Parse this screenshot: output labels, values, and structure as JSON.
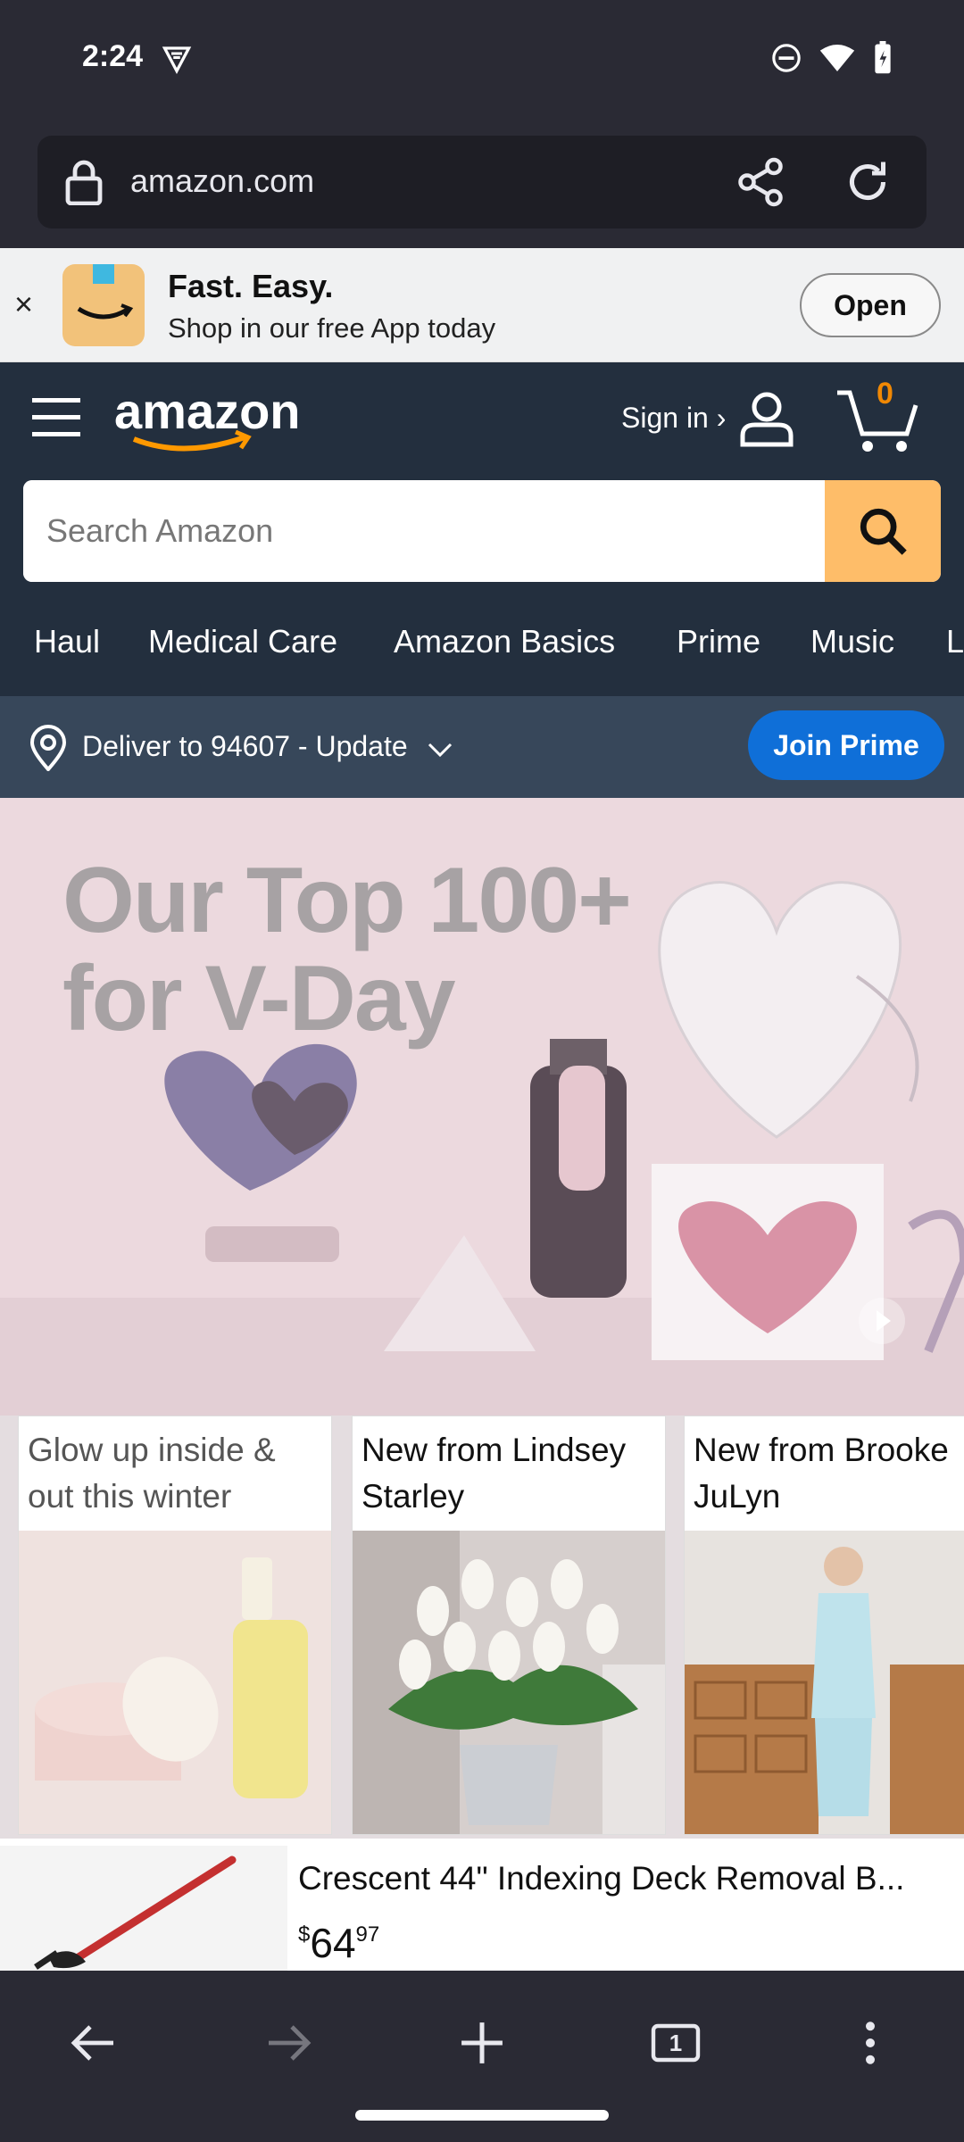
{
  "status": {
    "time": "2:24"
  },
  "browser": {
    "url": "amazon.com",
    "tab_count": "1"
  },
  "banner": {
    "close_label": "×",
    "title": "Fast. Easy.",
    "subtitle": "Shop in our free App today",
    "open_label": "Open"
  },
  "header": {
    "sign_in": "Sign in ›",
    "cart_count": "0",
    "search_placeholder": "Search Amazon",
    "nav_items": [
      "Haul",
      "Medical Care",
      "Amazon Basics",
      "Prime",
      "Music",
      "L"
    ]
  },
  "delivery": {
    "text": "Deliver to 94607 - Update",
    "join_prime": "Join Prime"
  },
  "hero": {
    "line1": "Our Top 100+",
    "line2": "for V-Day"
  },
  "cards": [
    {
      "title": "Glow up inside & out this winter"
    },
    {
      "title": "New from Lindsey Starley"
    },
    {
      "title": "New from Brooke JuLyn"
    }
  ],
  "product": {
    "name": "Crescent 44\" Indexing Deck Removal B...",
    "price_symbol": "$",
    "price_whole": "64",
    "price_fraction": "97"
  },
  "colors": {
    "amazon_dark": "#232f3e",
    "delivery_bar": "#37475a",
    "search_button": "#febd69",
    "prime_blue": "#0f6fd8",
    "cart_orange": "#f08804"
  }
}
